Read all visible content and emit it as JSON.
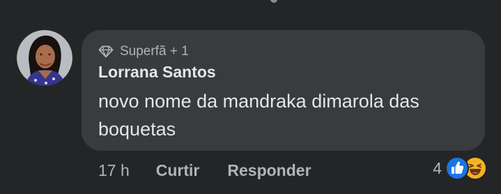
{
  "comment": {
    "badge": "Superfã + 1",
    "badge_icon": "diamond-icon",
    "author": "Lorrana Santos",
    "text": "novo nome da mandraka dimarola das boquetas"
  },
  "actions": {
    "time": "17 h",
    "like": "Curtir",
    "reply": "Responder"
  },
  "reactions": {
    "count": "4",
    "types": [
      "like",
      "haha"
    ]
  },
  "colors": {
    "background": "#242526",
    "bubble": "#3a3b3c",
    "primary_text": "#e4e6eb",
    "secondary_text": "#b0b3b8",
    "like_blue": "#1b74e4",
    "haha_yellow": "#f7b125"
  }
}
